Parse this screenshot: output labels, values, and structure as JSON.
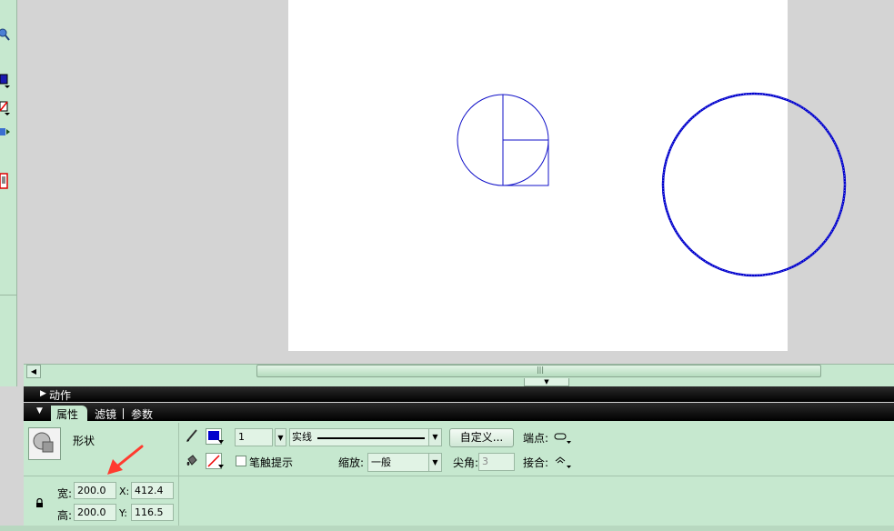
{
  "panels": {
    "actions_label": "动作",
    "tabs": [
      {
        "label": "属性",
        "active": true
      },
      {
        "label": "滤镜",
        "active": false
      },
      {
        "label": "参数",
        "active": false
      }
    ]
  },
  "properties": {
    "shape_type": "形状",
    "stroke_height": "1",
    "stroke_style": "实线",
    "custom_button": "自定义...",
    "cap_label": "端点:",
    "stroke_hint_label": "笔触提示",
    "scale_label": "缩放:",
    "scale_value": "一般",
    "miter_label": "尖角:",
    "miter_value": "3",
    "join_label": "接合:",
    "width_label": "宽:",
    "width_value": "200.0",
    "height_label": "高:",
    "height_value": "200.0",
    "x_label": "X:",
    "x_value": "412.4",
    "y_label": "Y:",
    "y_value": "116.5",
    "stroke_color": "#0000cc",
    "fill_color": "none"
  },
  "colors": {
    "panel_bg": "#c6e8cf",
    "shape_stroke": "#0000cc",
    "annotation_arrow": "#ff3b2f"
  }
}
